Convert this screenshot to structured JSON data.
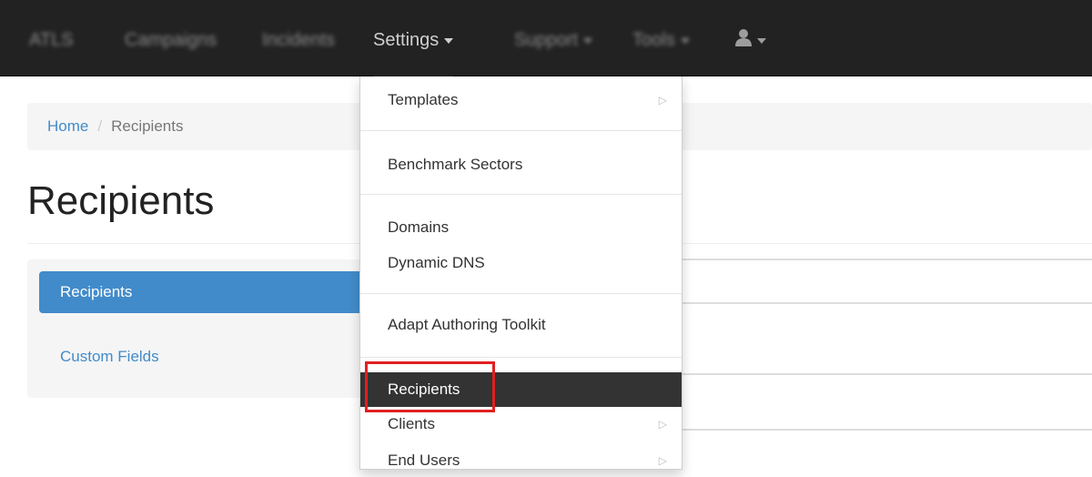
{
  "navbar": {
    "brand": "ATLS",
    "items": [
      {
        "label": "Campaigns"
      },
      {
        "label": "Incidents"
      },
      {
        "label": "Settings"
      },
      {
        "label": "Support"
      },
      {
        "label": "Tools"
      }
    ],
    "user_icon": "user-icon"
  },
  "breadcrumb": {
    "home": "Home",
    "separator": "/",
    "current": "Recipients"
  },
  "page": {
    "title": "Recipients"
  },
  "sidebar": {
    "items": [
      {
        "label": "Recipients",
        "active": true
      },
      {
        "label": "Custom Fields",
        "active": false
      }
    ]
  },
  "settings_menu": {
    "items": [
      {
        "label": "Templates",
        "has_submenu": true
      },
      {
        "label": "Benchmark Sectors",
        "has_submenu": false
      },
      {
        "label": "Domains",
        "has_submenu": false
      },
      {
        "label": "Dynamic DNS",
        "has_submenu": false
      },
      {
        "label": "Adapt Authoring Toolkit",
        "has_submenu": false
      },
      {
        "label": "Recipients",
        "has_submenu": false,
        "highlighted": true
      },
      {
        "label": "Clients",
        "has_submenu": true
      },
      {
        "label": "End Users",
        "has_submenu": true
      }
    ],
    "submenu_glyph": "▷"
  },
  "colors": {
    "navbar_bg": "#222222",
    "link": "#428bca",
    "active_bg": "#428bca",
    "highlight_bg": "#333333",
    "annotation_border": "#e02020"
  }
}
